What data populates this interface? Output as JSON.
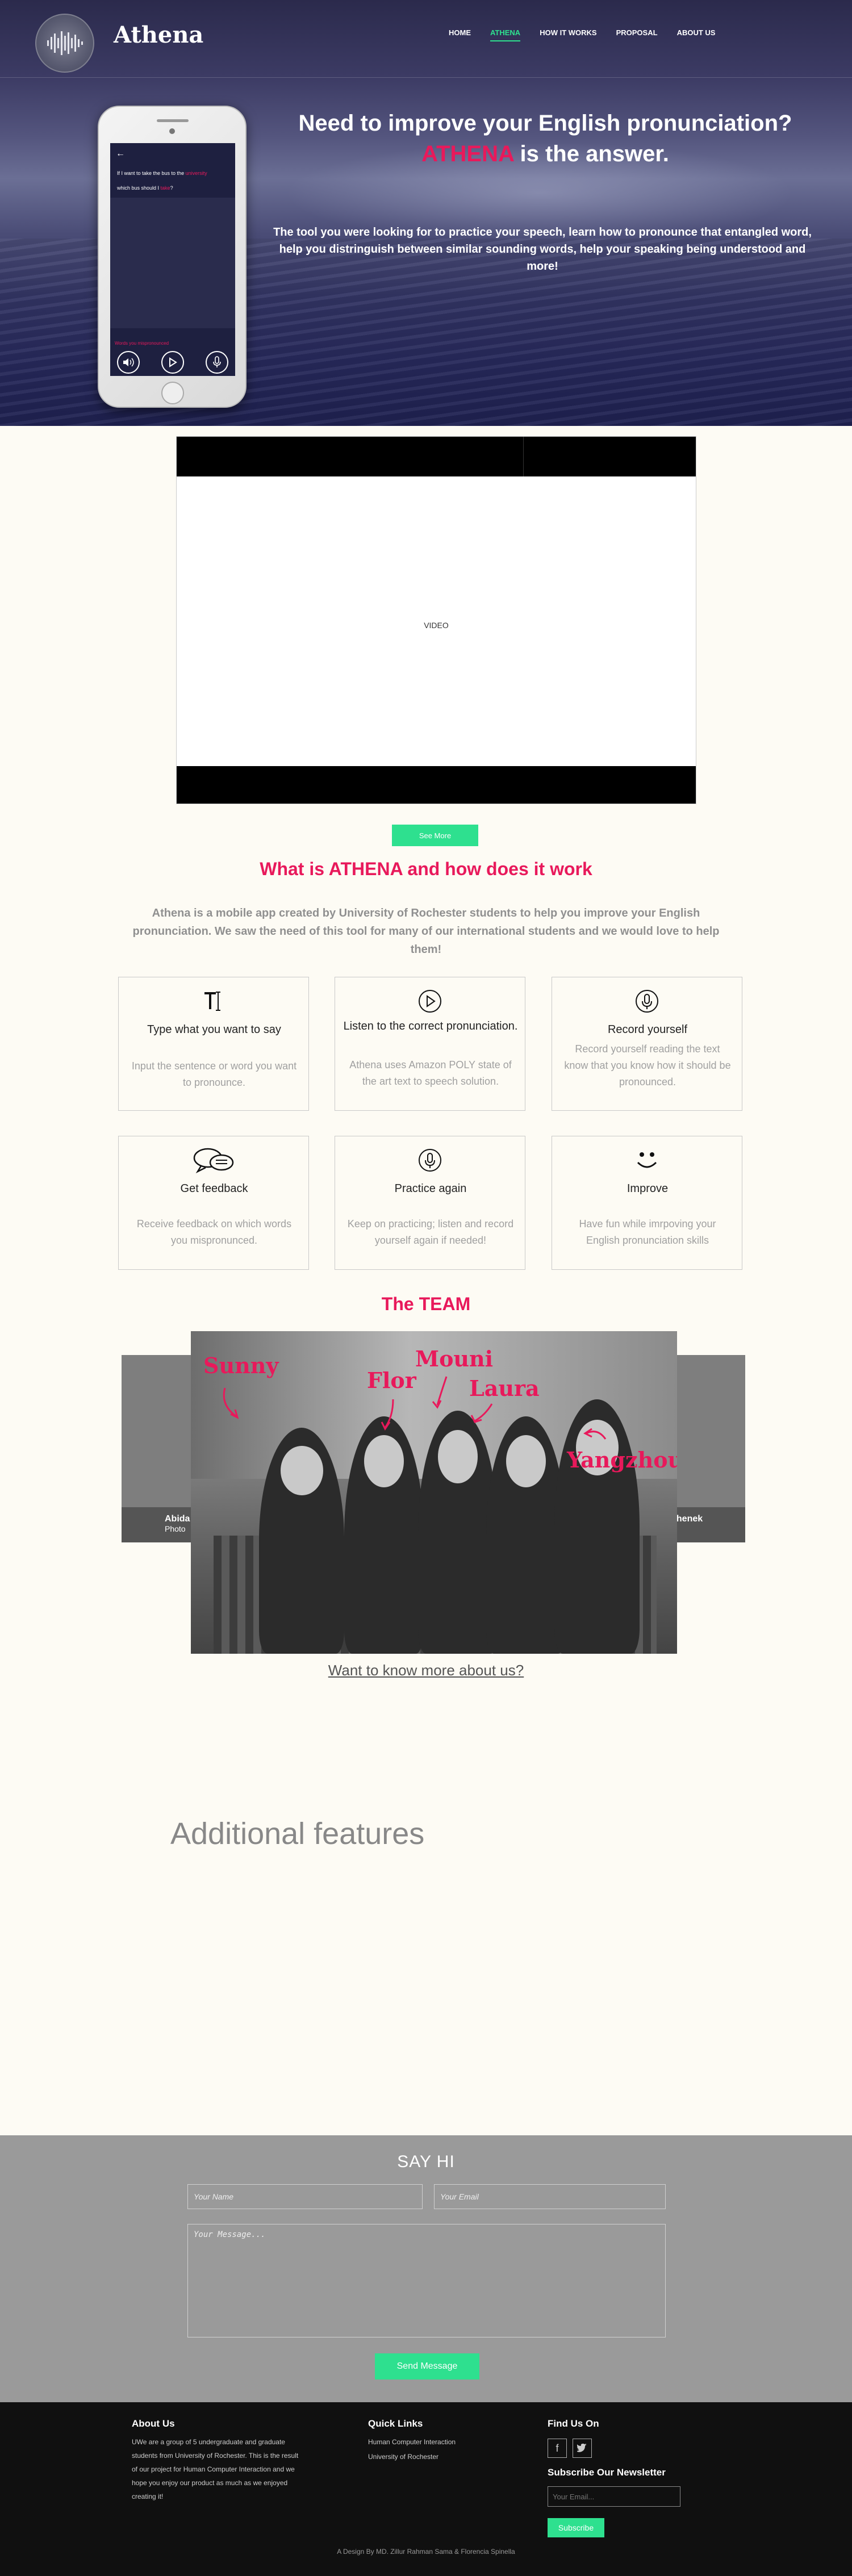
{
  "header": {
    "brand": "Athena",
    "nav": [
      "HOME",
      "ATHENA",
      "HOW IT WORKS",
      "PROPOSAL",
      "ABOUT US"
    ],
    "active_nav": "ATHENA",
    "headline_line1": "Need to improve your  English pronunciation?",
    "headline_pink": "ATHENA",
    "headline_rest": " is the answer.",
    "subtext": "The tool you were looking for to practice your speech, learn how to pronounce that entangled word, help you distringuish between similar sounding words, help your speaking being understood  and more!"
  },
  "phone": {
    "line1_pre": "If I want to take the bus to the ",
    "line1_red": "university",
    "line2_pre": "which bus should I ",
    "line2_red": "take",
    "line2_post": "?",
    "prompt": "Words you mispronounced"
  },
  "video": {
    "label": "VIDEO"
  },
  "see_more": "See More",
  "about": {
    "title": "What is ATHENA and how does it work",
    "intro": "Athena is a mobile app created by University of Rochester students to help you improve your English pronunciation. We saw the need of this tool for many of our international students and we would love to help them!"
  },
  "features": [
    {
      "icon": "text-cursor-icon",
      "title": "Type what you want to say",
      "desc": "Input the sentence or word you want to pronounce."
    },
    {
      "icon": "play-icon",
      "title": "Listen to the correct pronunciation.",
      "desc": "Athena uses Amazon POLY state of the art text to speech solution."
    },
    {
      "icon": "microphone-icon",
      "title": "Record yourself",
      "desc": "Record yourself reading the text know that you know how it should be pronounced."
    },
    {
      "icon": "chat-icon",
      "title": "Get feedback",
      "desc": "Receive feedback on which words you mispronunced."
    },
    {
      "icon": "microphone-icon",
      "title": "Practice again",
      "desc": "Keep on practicing; listen and record yourself again if needed!"
    },
    {
      "icon": "smiley-icon",
      "title": "Improve",
      "desc": "Have fun while imrpoving your English pronunciation skills"
    }
  ],
  "team": {
    "title": "The TEAM",
    "left_name": "Abida",
    "left_role": "Photo",
    "right_name": "chenek",
    "names": [
      "Sunny",
      "Flor",
      "Mouni",
      "Laura",
      "Yangzhou"
    ],
    "more_link": "Want to know more about us?"
  },
  "additional": {
    "title": "Additional features"
  },
  "contact": {
    "title": "SAY HI",
    "name_placeholder": "Your Name",
    "email_placeholder": "Your Email",
    "message_placeholder": "Your Message...",
    "send": "Send Message"
  },
  "footer": {
    "about_title": "About Us",
    "about_text": "UWe are a group of 5 undergraduate and graduate students from University of Rochester. This is the result of our project for Human Computer Interaction and we  hope you enjoy our product as much as we enjoyed creating it!",
    "links_title": "Quick Links",
    "links": [
      "Human Computer Interaction",
      "University of Rochester"
    ],
    "find_title": "Find Us On",
    "social": [
      "facebook-icon",
      "twitter-icon"
    ],
    "newsletter_title": "Subscribe Our Newsletter",
    "newsletter_placeholder": "Your Email...",
    "subscribe": "Subscribe",
    "credit": "A Design By MD. Zillur Rahman Sama & Florencia Spinella"
  },
  "colors": {
    "accent_pink": "#e8195b",
    "accent_green": "#2ee08f",
    "footer_bg": "#101010"
  }
}
